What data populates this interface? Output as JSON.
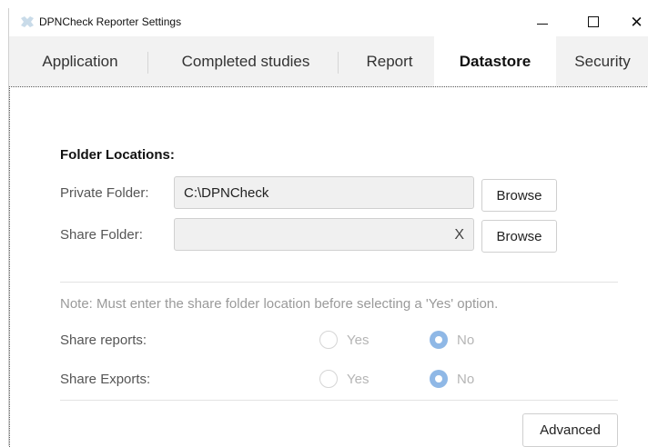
{
  "window": {
    "title": "DPNCheck Reporter Settings"
  },
  "tabs": [
    {
      "label": "Application"
    },
    {
      "label": "Completed studies"
    },
    {
      "label": "Report"
    },
    {
      "label": "Datastore"
    },
    {
      "label": "Security"
    }
  ],
  "datastore": {
    "heading": "Folder Locations:",
    "private_label": "Private Folder:",
    "private_value": "C:\\DPNCheck",
    "share_label": "Share Folder:",
    "share_value": "",
    "clear_label": "X",
    "browse_label": "Browse",
    "note": "Note: Must enter the share folder location before selecting a 'Yes' option.",
    "share_reports_label": "Share reports:",
    "share_exports_label": "Share Exports:",
    "yes_label": "Yes",
    "no_label": "No",
    "share_reports_selected": "No",
    "share_exports_selected": "No",
    "advanced_label": "Advanced"
  },
  "colors": {
    "radio_selected": "#8fb8e6",
    "tab_bar": "#f2f2f2"
  }
}
